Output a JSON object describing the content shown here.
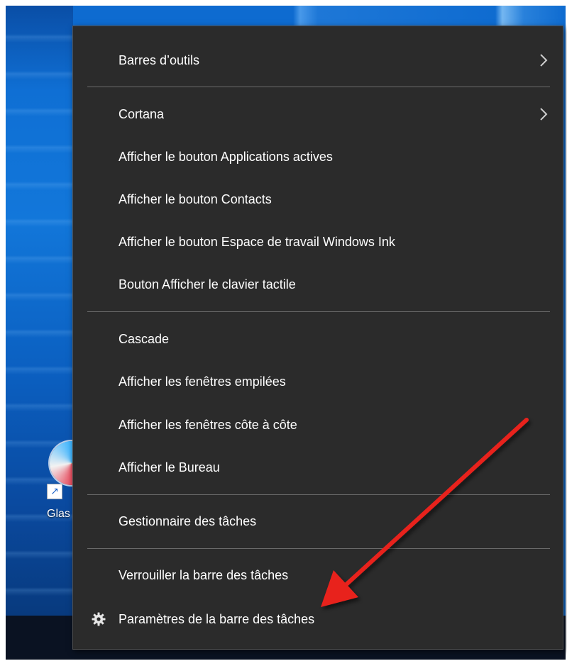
{
  "desktop": {
    "shortcut_label": "Glas",
    "shortcut_overlay_icon": "shortcut-arrow-icon"
  },
  "context_menu": {
    "items": [
      {
        "label": "Barres d’outils",
        "has_submenu": true,
        "icon": ""
      },
      {
        "label": "Cortana",
        "has_submenu": true,
        "icon": ""
      },
      {
        "label": "Afficher le bouton Applications actives",
        "has_submenu": false,
        "icon": ""
      },
      {
        "label": "Afficher le bouton Contacts",
        "has_submenu": false,
        "icon": ""
      },
      {
        "label": "Afficher le bouton Espace de travail Windows Ink",
        "has_submenu": false,
        "icon": ""
      },
      {
        "label": "Bouton Afficher le clavier tactile",
        "has_submenu": false,
        "icon": ""
      },
      {
        "label": "Cascade",
        "has_submenu": false,
        "icon": ""
      },
      {
        "label": "Afficher les fenêtres empilées",
        "has_submenu": false,
        "icon": ""
      },
      {
        "label": "Afficher les fenêtres côte à côte",
        "has_submenu": false,
        "icon": ""
      },
      {
        "label": "Afficher le Bureau",
        "has_submenu": false,
        "icon": ""
      },
      {
        "label": "Gestionnaire des tâches",
        "has_submenu": false,
        "icon": ""
      },
      {
        "label": "Verrouiller la barre des tâches",
        "has_submenu": false,
        "icon": ""
      },
      {
        "label": "Paramètres de la barre des tâches",
        "has_submenu": false,
        "icon": "gear-icon"
      }
    ]
  },
  "annotation": {
    "arrow_color": "#e8201e",
    "points_to": "Paramètres de la barre des tâches"
  },
  "colors": {
    "menu_background": "#2b2b2b",
    "menu_text": "#ffffff",
    "separator": "#6b6b6b"
  }
}
